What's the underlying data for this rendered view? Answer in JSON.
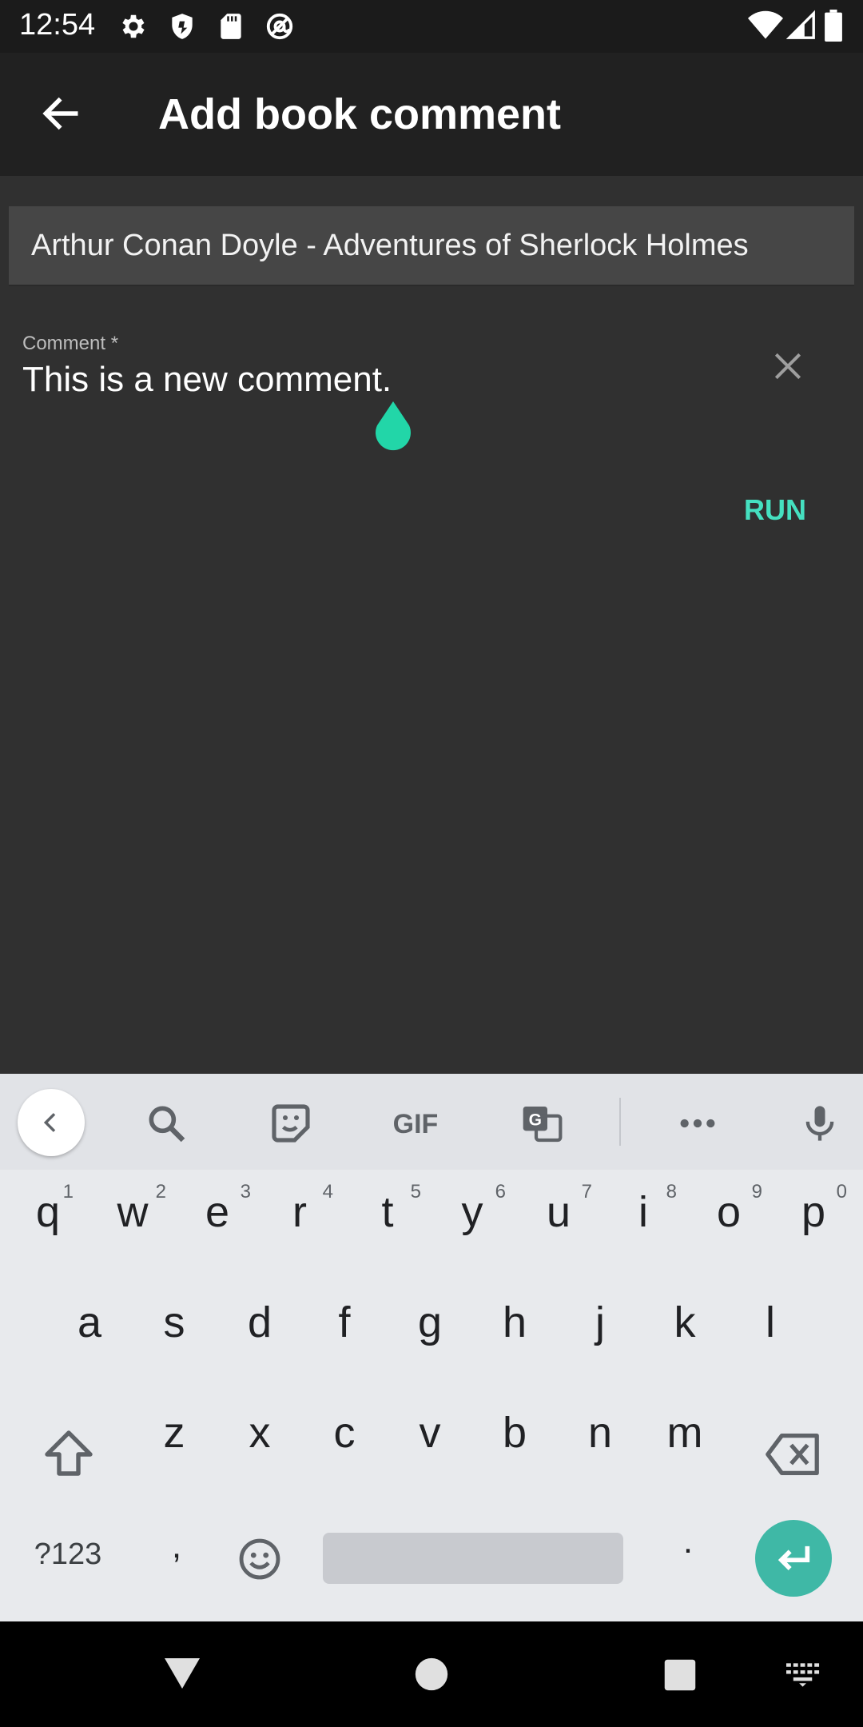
{
  "status_bar": {
    "time": "12:54",
    "icons_left": [
      "gear-icon",
      "shield-icon",
      "sd-card-icon",
      "at-sign-icon"
    ],
    "icons_right": [
      "wifi-icon",
      "signal-icon",
      "battery-icon"
    ]
  },
  "app_bar": {
    "title": "Add book comment",
    "back_icon": "arrow-back-icon"
  },
  "book_field": {
    "value": "Arthur Conan Doyle - Adventures of Sherlock Holmes"
  },
  "comment_field": {
    "label": "Comment *",
    "value": "This is a new comment.",
    "clear_icon": "close-icon"
  },
  "actions": {
    "run_label": "RUN"
  },
  "colors": {
    "accent": "#45e0c0",
    "cursor_handle": "#22d6a8",
    "background": "#303030",
    "app_bar": "#212121",
    "keyboard_bg": "#e8eaed",
    "enter_key": "#3fb8a6"
  },
  "keyboard": {
    "toolbar": {
      "gif_label": "GIF",
      "icons": [
        "chevron-left-icon",
        "search-icon",
        "sticker-icon",
        "gif-icon",
        "translate-icon",
        "more-icon",
        "mic-icon"
      ]
    },
    "row1": [
      {
        "ch": "q",
        "hint": "1"
      },
      {
        "ch": "w",
        "hint": "2"
      },
      {
        "ch": "e",
        "hint": "3"
      },
      {
        "ch": "r",
        "hint": "4"
      },
      {
        "ch": "t",
        "hint": "5"
      },
      {
        "ch": "y",
        "hint": "6"
      },
      {
        "ch": "u",
        "hint": "7"
      },
      {
        "ch": "i",
        "hint": "8"
      },
      {
        "ch": "o",
        "hint": "9"
      },
      {
        "ch": "p",
        "hint": "0"
      }
    ],
    "row2": [
      "a",
      "s",
      "d",
      "f",
      "g",
      "h",
      "j",
      "k",
      "l"
    ],
    "row3": [
      "z",
      "x",
      "c",
      "v",
      "b",
      "n",
      "m"
    ],
    "symbols_label": "?123",
    "comma_label": ",",
    "period_label": "."
  },
  "nav_bar": {
    "icons": [
      "back-triangle-icon",
      "home-circle-icon",
      "recents-square-icon",
      "keyboard-switch-icon"
    ]
  }
}
